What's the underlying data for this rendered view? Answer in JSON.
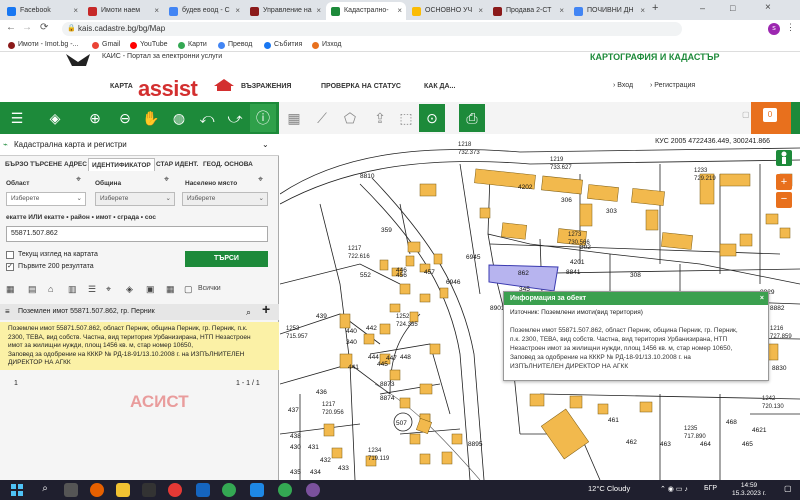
{
  "browser": {
    "tabs": [
      {
        "label": "Facebook",
        "color": "#1877f2"
      },
      {
        "label": "Имоти наем",
        "color": "#c62828"
      },
      {
        "label": "будев еоод - С",
        "color": "#4285f4"
      },
      {
        "label": "Управление на",
        "color": "#8b1a1a"
      },
      {
        "label": "Кадастрално-",
        "color": "#1d8a3a"
      },
      {
        "label": "ОСНОВНО УЧ",
        "color": "#fbbc04"
      },
      {
        "label": "Продава 2-СТ",
        "color": "#8b1a1a"
      },
      {
        "label": "ПОЧИВНИ ДН",
        "color": "#4285f4"
      }
    ],
    "url": "kais.cadastre.bg/bg/Map",
    "bookmarks": [
      "Имоти - Imot.bg -...",
      "Gmail",
      "YouTube",
      "Карти",
      "Превод",
      "Събития",
      "Изход"
    ]
  },
  "site": {
    "portal_caption": "КАИС - Портал за електронни услуги",
    "agency": "КАРТОГРАФИЯ И КАДАСТЪР",
    "brand": "assist",
    "nav": [
      "КАРТА",
      "ВЪЗРАЖЕНИЯ",
      "ПРОВЕРКА НА СТАТУС",
      "КАК ДА..."
    ],
    "login": "Вход",
    "register": "Регистрация"
  },
  "panel": {
    "title": "Кадастрална карта и регистри",
    "tabs": [
      "БЪРЗО ТЪРСЕНЕ",
      "АДРЕС",
      "ИДЕНТИФИКАТОР",
      "СТАР ИДЕНТ.",
      "ГЕОД. ОСНОВА"
    ],
    "area_label": "Област",
    "municipality_label": "Община",
    "place_label": "Населено място",
    "select_placeholder": "Изберете",
    "search_hint": "екатте ИЛИ екатте • район • имот • сграда • сос",
    "search_value": "55871.507.862",
    "checkbox_current_view": "Текущ изглед на картата",
    "checkbox_first200": "Първите 200 резултата",
    "search_button": "ТЪРСИ",
    "all_label": "Всички",
    "result_title": "Поземлен имот 55871.507.862, гр. Перник",
    "result_text_1": "Поземлен имот 55871.507.862, област Перник, община Перник, гр. Перник, п.к.",
    "result_text_2": "2300, ТЕВА, вид собств. Частна, вид територия Урбанизирана, НТП Незастроен",
    "result_text_3": "имот за жилищни нужди, площ 1456 кв. м, стар номер 10650,",
    "result_text_4": "Заповед за одобрение на КККР № РД-18-91/13.10.2008 г. на ИЗПЪЛНИТЕЛЕН ДИРЕКТОР НА АГКК",
    "page": "1",
    "range": "1 - 1 / 1",
    "watermark": "АСИСТ"
  },
  "map": {
    "coordinate_readout": "КУС 2005 4722436.449, 300241.866",
    "parcel_selected": "862",
    "parcel_labels": [
      "8841",
      "308",
      "345",
      "306",
      "359",
      "552",
      "6945",
      "8810",
      "439",
      "440",
      "442",
      "445",
      "441",
      "446",
      "437",
      "438",
      "436",
      "8895",
      "8901",
      "8882",
      "8829",
      "8830",
      "461",
      "462",
      "463",
      "464",
      "465",
      "4621",
      "468",
      "6946",
      "303",
      "302",
      "4201",
      "4202",
      "340",
      "8873",
      "8874",
      "444",
      "447",
      "448",
      "456",
      "457",
      "430",
      "431",
      "432",
      "433",
      "434",
      "435",
      "507"
    ],
    "height_labels": [
      "1218",
      "732.373",
      "1219",
      "733.627",
      "1273",
      "730.566",
      "1217",
      "722.616",
      "1233",
      "729.219",
      "1252",
      "724.335",
      "1253",
      "715.957",
      "1217",
      "720.956",
      "1234",
      "719.119",
      "1235",
      "717.890",
      "1242",
      "720.130",
      "1216",
      "727.859"
    ]
  },
  "popup": {
    "title": "Информация за обект",
    "source": "Източник: Поземлени имоти(вид територия)",
    "body_1": "Поземлен имот 55871.507.862, област Перник, община Перник, гр. Перник,",
    "body_2": "п.к. 2300, ТЕВА, вид собств. Частна, вид територия Урбанизирана, НТП",
    "body_3": "Незастроен имот за жилищни нужди, площ 1456 кв. м, стар номер 10650,",
    "body_4": "Заповед за одобрение на КККР № РД-18-91/13.10.2008 г. на",
    "body_5": "ИЗПЪЛНИТЕЛЕН ДИРЕКТОР НА АГКК"
  },
  "taskbar": {
    "weather": "12°C  Cloudy",
    "lang": "БГР",
    "time": "14:59",
    "date": "15.3.2023 г."
  },
  "colors": {
    "accent": "#1d8a3a",
    "building": "#f2b94d",
    "selected_parcel": "#b7b4ef",
    "result_bg": "#fbf1a6",
    "orange": "#e8701d"
  }
}
